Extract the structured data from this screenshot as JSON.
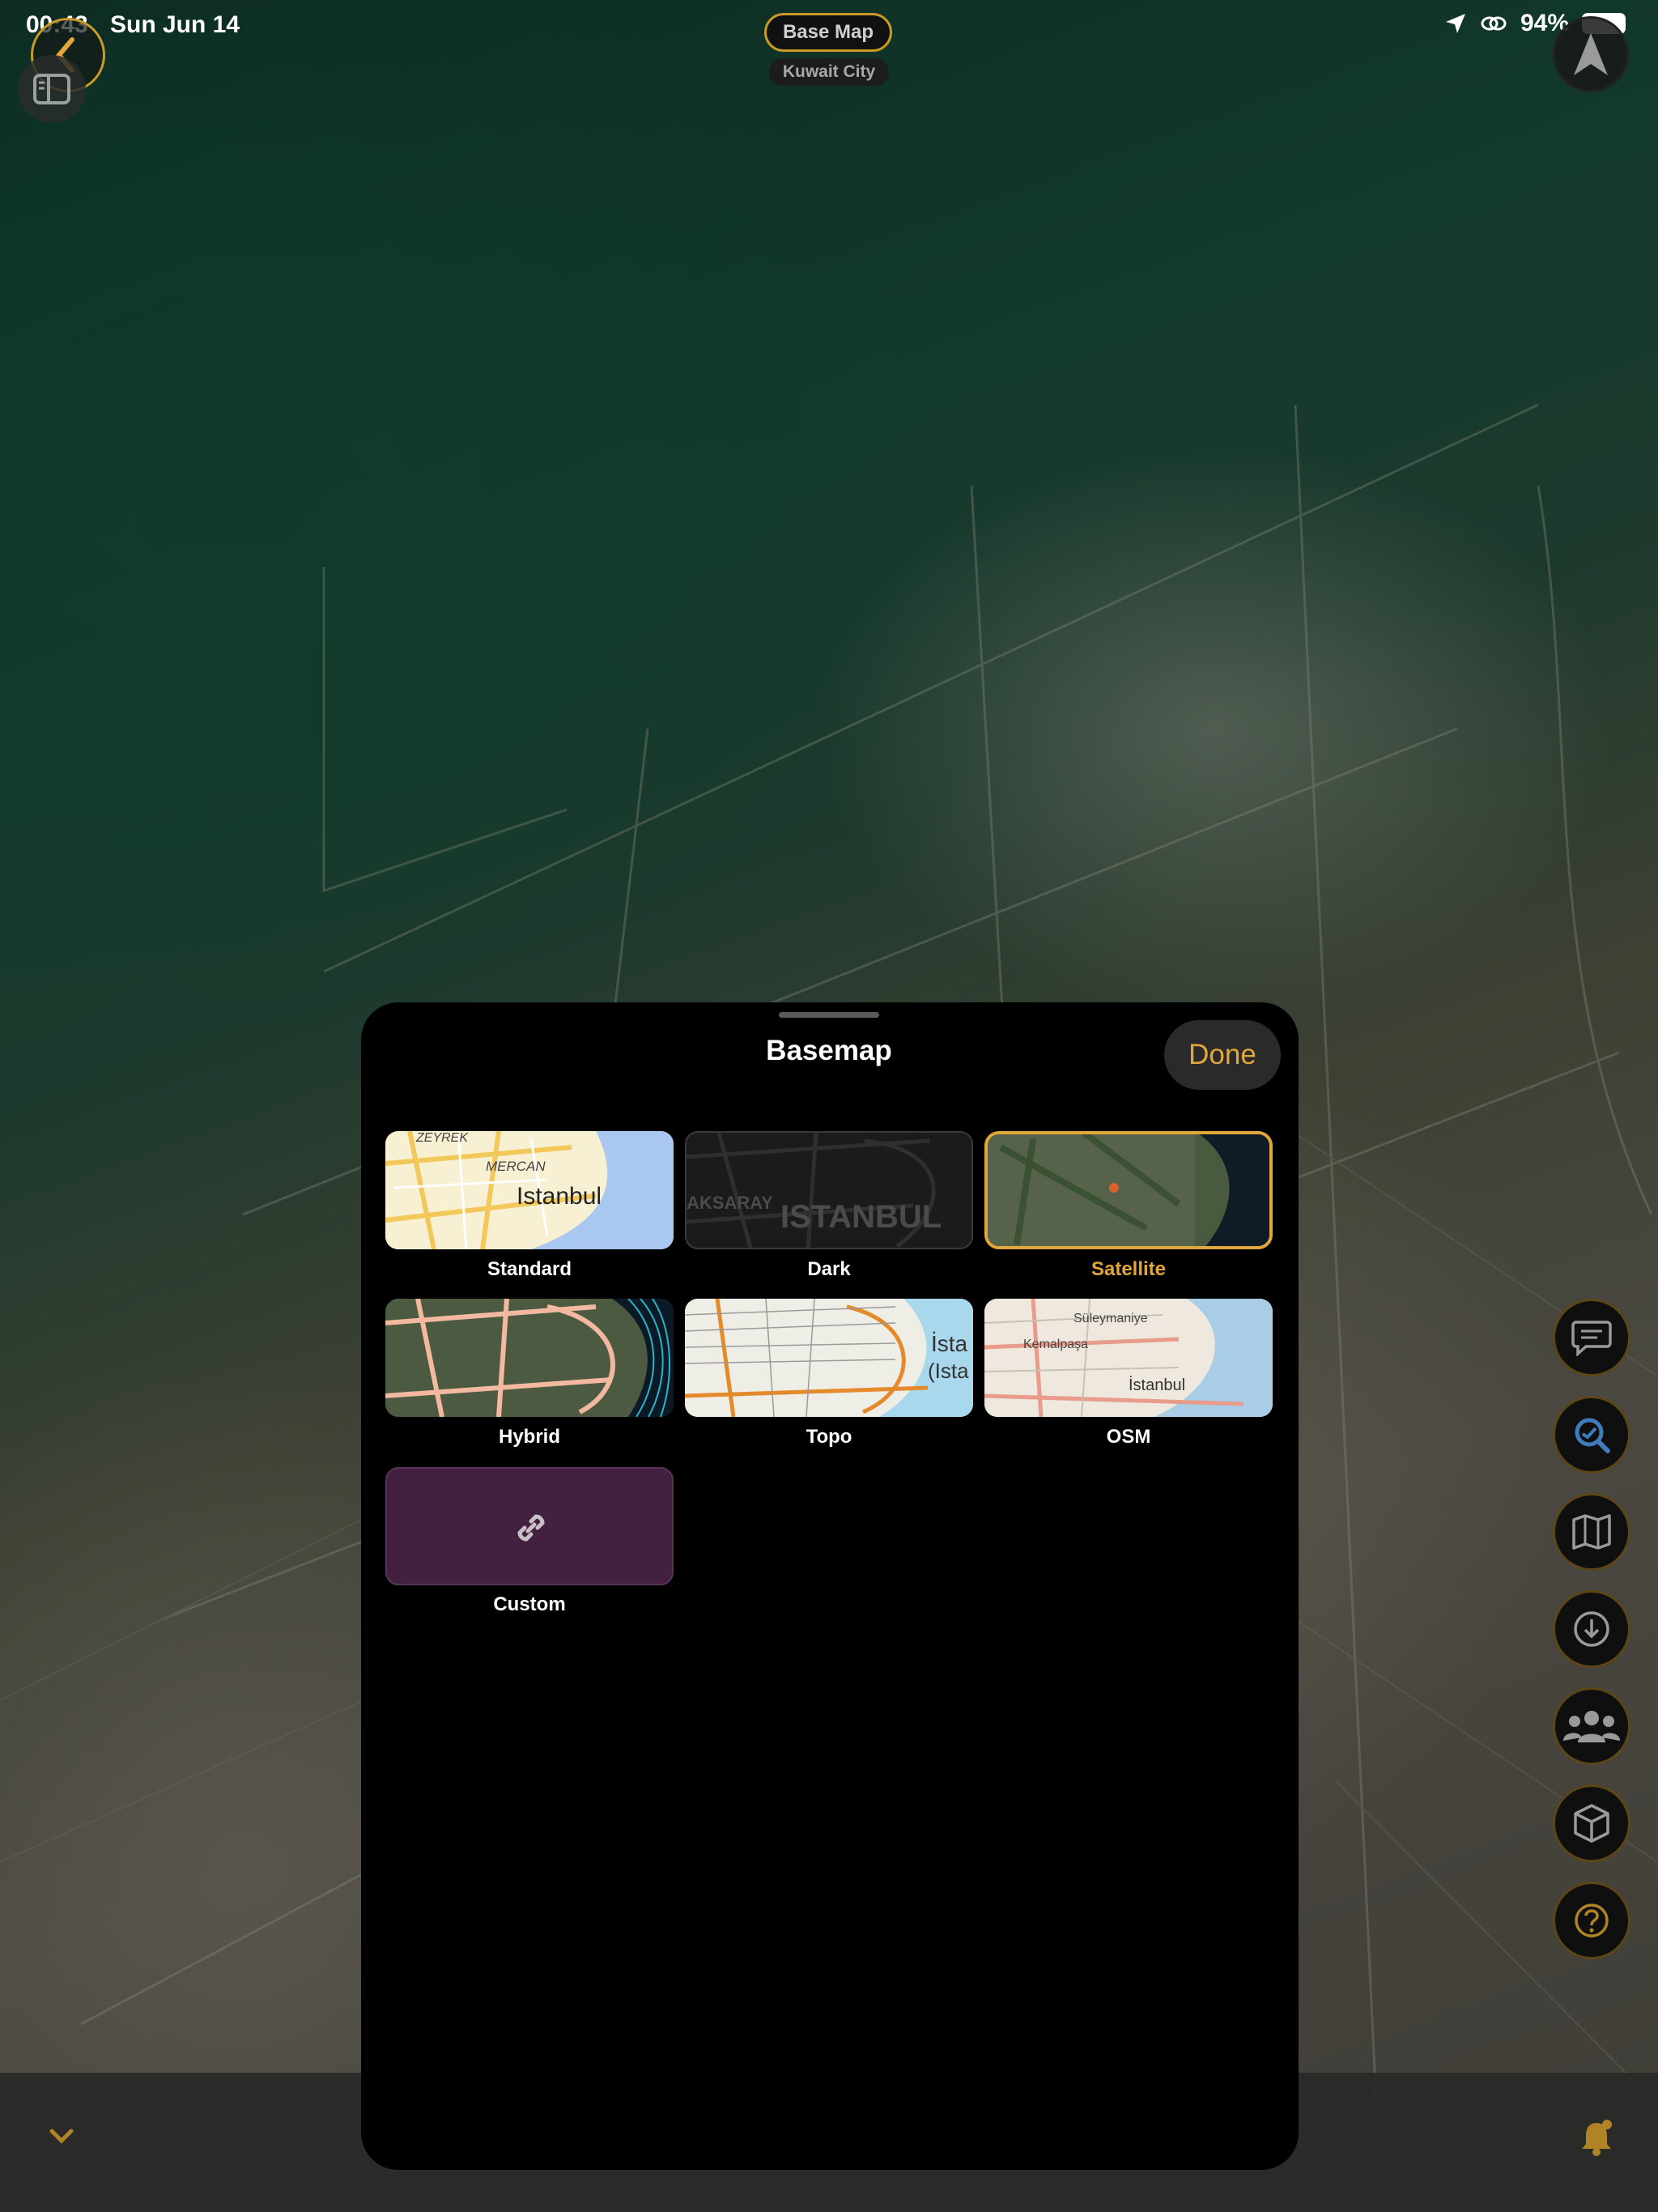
{
  "status_bar": {
    "time": "00:43",
    "date": "Sun Jun 14",
    "battery": "94%"
  },
  "map_header": {
    "title": "Base Map",
    "subtitle": "Kuwait City"
  },
  "sheet": {
    "title": "Basemap",
    "done_label": "Done",
    "options": [
      {
        "label": "Standard",
        "selected": false,
        "thumb_text": "Istanbul",
        "thumb_sub1": "ZEYREK",
        "thumb_sub2": "MERCAN"
      },
      {
        "label": "Dark",
        "selected": false,
        "thumb_text": "ISTANBUL",
        "thumb_sub1": "AKSARAY"
      },
      {
        "label": "Satellite",
        "selected": true
      },
      {
        "label": "Hybrid",
        "selected": false
      },
      {
        "label": "Topo",
        "selected": false,
        "thumb_text": "İsta",
        "thumb_sub1": "(Ista"
      },
      {
        "label": "OSM",
        "selected": false,
        "thumb_text": "İstanbul",
        "thumb_sub1": "Süleymaniye",
        "thumb_sub2": "Kemalpaşa"
      },
      {
        "label": "Custom",
        "selected": false
      }
    ]
  },
  "right_rail": [
    {
      "name": "chat-button",
      "icon": "message-icon"
    },
    {
      "name": "search-button",
      "icon": "search-icon"
    },
    {
      "name": "map-button",
      "icon": "map-icon"
    },
    {
      "name": "download-button",
      "icon": "download-icon"
    },
    {
      "name": "people-button",
      "icon": "people-icon"
    },
    {
      "name": "3d-button",
      "icon": "cube-icon"
    },
    {
      "name": "help-button",
      "icon": "help-icon"
    }
  ],
  "colors": {
    "accent": "#e2a73a",
    "sheet_bg": "#000000",
    "custom_tile": "#43203f"
  }
}
